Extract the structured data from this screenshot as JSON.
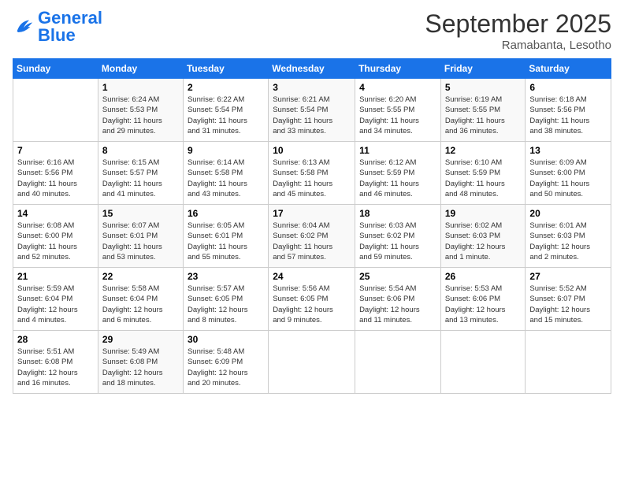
{
  "logo": {
    "line1": "General",
    "line2": "Blue"
  },
  "title": "September 2025",
  "subtitle": "Ramabanta, Lesotho",
  "days_of_week": [
    "Sunday",
    "Monday",
    "Tuesday",
    "Wednesday",
    "Thursday",
    "Friday",
    "Saturday"
  ],
  "weeks": [
    [
      {
        "day": "",
        "info": ""
      },
      {
        "day": "1",
        "info": "Sunrise: 6:24 AM\nSunset: 5:53 PM\nDaylight: 11 hours\nand 29 minutes."
      },
      {
        "day": "2",
        "info": "Sunrise: 6:22 AM\nSunset: 5:54 PM\nDaylight: 11 hours\nand 31 minutes."
      },
      {
        "day": "3",
        "info": "Sunrise: 6:21 AM\nSunset: 5:54 PM\nDaylight: 11 hours\nand 33 minutes."
      },
      {
        "day": "4",
        "info": "Sunrise: 6:20 AM\nSunset: 5:55 PM\nDaylight: 11 hours\nand 34 minutes."
      },
      {
        "day": "5",
        "info": "Sunrise: 6:19 AM\nSunset: 5:55 PM\nDaylight: 11 hours\nand 36 minutes."
      },
      {
        "day": "6",
        "info": "Sunrise: 6:18 AM\nSunset: 5:56 PM\nDaylight: 11 hours\nand 38 minutes."
      }
    ],
    [
      {
        "day": "7",
        "info": "Sunrise: 6:16 AM\nSunset: 5:56 PM\nDaylight: 11 hours\nand 40 minutes."
      },
      {
        "day": "8",
        "info": "Sunrise: 6:15 AM\nSunset: 5:57 PM\nDaylight: 11 hours\nand 41 minutes."
      },
      {
        "day": "9",
        "info": "Sunrise: 6:14 AM\nSunset: 5:58 PM\nDaylight: 11 hours\nand 43 minutes."
      },
      {
        "day": "10",
        "info": "Sunrise: 6:13 AM\nSunset: 5:58 PM\nDaylight: 11 hours\nand 45 minutes."
      },
      {
        "day": "11",
        "info": "Sunrise: 6:12 AM\nSunset: 5:59 PM\nDaylight: 11 hours\nand 46 minutes."
      },
      {
        "day": "12",
        "info": "Sunrise: 6:10 AM\nSunset: 5:59 PM\nDaylight: 11 hours\nand 48 minutes."
      },
      {
        "day": "13",
        "info": "Sunrise: 6:09 AM\nSunset: 6:00 PM\nDaylight: 11 hours\nand 50 minutes."
      }
    ],
    [
      {
        "day": "14",
        "info": "Sunrise: 6:08 AM\nSunset: 6:00 PM\nDaylight: 11 hours\nand 52 minutes."
      },
      {
        "day": "15",
        "info": "Sunrise: 6:07 AM\nSunset: 6:01 PM\nDaylight: 11 hours\nand 53 minutes."
      },
      {
        "day": "16",
        "info": "Sunrise: 6:05 AM\nSunset: 6:01 PM\nDaylight: 11 hours\nand 55 minutes."
      },
      {
        "day": "17",
        "info": "Sunrise: 6:04 AM\nSunset: 6:02 PM\nDaylight: 11 hours\nand 57 minutes."
      },
      {
        "day": "18",
        "info": "Sunrise: 6:03 AM\nSunset: 6:02 PM\nDaylight: 11 hours\nand 59 minutes."
      },
      {
        "day": "19",
        "info": "Sunrise: 6:02 AM\nSunset: 6:03 PM\nDaylight: 12 hours\nand 1 minute."
      },
      {
        "day": "20",
        "info": "Sunrise: 6:01 AM\nSunset: 6:03 PM\nDaylight: 12 hours\nand 2 minutes."
      }
    ],
    [
      {
        "day": "21",
        "info": "Sunrise: 5:59 AM\nSunset: 6:04 PM\nDaylight: 12 hours\nand 4 minutes."
      },
      {
        "day": "22",
        "info": "Sunrise: 5:58 AM\nSunset: 6:04 PM\nDaylight: 12 hours\nand 6 minutes."
      },
      {
        "day": "23",
        "info": "Sunrise: 5:57 AM\nSunset: 6:05 PM\nDaylight: 12 hours\nand 8 minutes."
      },
      {
        "day": "24",
        "info": "Sunrise: 5:56 AM\nSunset: 6:05 PM\nDaylight: 12 hours\nand 9 minutes."
      },
      {
        "day": "25",
        "info": "Sunrise: 5:54 AM\nSunset: 6:06 PM\nDaylight: 12 hours\nand 11 minutes."
      },
      {
        "day": "26",
        "info": "Sunrise: 5:53 AM\nSunset: 6:06 PM\nDaylight: 12 hours\nand 13 minutes."
      },
      {
        "day": "27",
        "info": "Sunrise: 5:52 AM\nSunset: 6:07 PM\nDaylight: 12 hours\nand 15 minutes."
      }
    ],
    [
      {
        "day": "28",
        "info": "Sunrise: 5:51 AM\nSunset: 6:08 PM\nDaylight: 12 hours\nand 16 minutes."
      },
      {
        "day": "29",
        "info": "Sunrise: 5:49 AM\nSunset: 6:08 PM\nDaylight: 12 hours\nand 18 minutes."
      },
      {
        "day": "30",
        "info": "Sunrise: 5:48 AM\nSunset: 6:09 PM\nDaylight: 12 hours\nand 20 minutes."
      },
      {
        "day": "",
        "info": ""
      },
      {
        "day": "",
        "info": ""
      },
      {
        "day": "",
        "info": ""
      },
      {
        "day": "",
        "info": ""
      }
    ]
  ]
}
